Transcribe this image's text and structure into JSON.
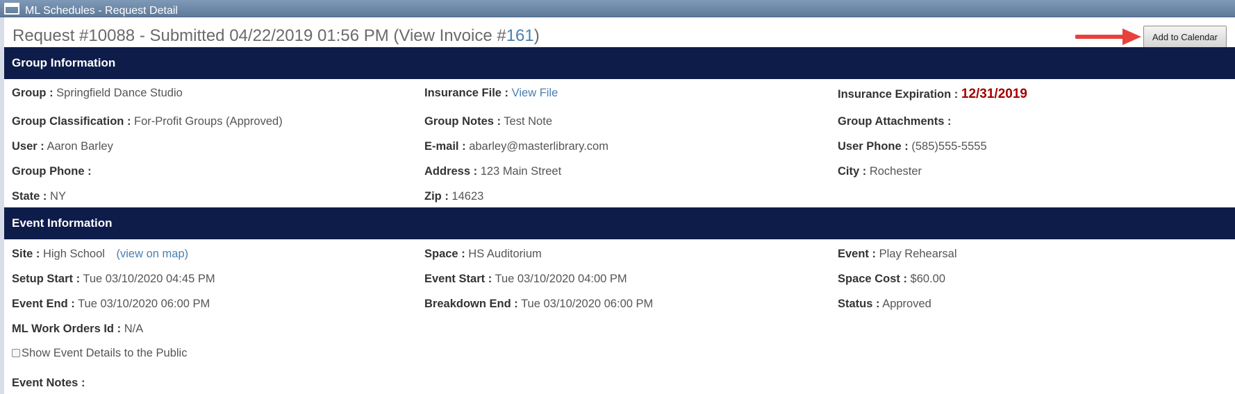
{
  "window": {
    "title": "ML Schedules - Request Detail"
  },
  "request": {
    "title_prefix": "Request #10088 - Submitted 04/22/2019 01:56 PM (View Invoice #",
    "invoice_number": "161",
    "title_suffix": ")"
  },
  "toolbar": {
    "add_to_calendar_label": "Add to Calendar",
    "arrow_color": "#e8413c"
  },
  "group_section": {
    "header": "Group Information",
    "group": {
      "label": "Group :",
      "value": "Springfield Dance Studio"
    },
    "insurance_file": {
      "label": "Insurance File :",
      "value": "View File"
    },
    "insurance_expiration": {
      "label": "Insurance Expiration :",
      "value": "12/31/2019"
    },
    "classification": {
      "label": "Group Classification :",
      "value": "For-Profit Groups (Approved)"
    },
    "notes": {
      "label": "Group Notes :",
      "value": "Test Note"
    },
    "attachments": {
      "label": "Group Attachments :",
      "value": ""
    },
    "user": {
      "label": "User :",
      "value": "Aaron Barley"
    },
    "email": {
      "label": "E-mail :",
      "value": "abarley@masterlibrary.com"
    },
    "user_phone": {
      "label": "User Phone :",
      "value": "(585)555-5555"
    },
    "group_phone": {
      "label": "Group Phone :",
      "value": ""
    },
    "address": {
      "label": "Address :",
      "value": "123 Main Street"
    },
    "city": {
      "label": "City :",
      "value": "Rochester"
    },
    "state": {
      "label": "State :",
      "value": "NY"
    },
    "zip": {
      "label": "Zip :",
      "value": "14623"
    }
  },
  "event_section": {
    "header": "Event Information",
    "site": {
      "label": "Site :",
      "value": "High School",
      "map_link": "(view on map)"
    },
    "space": {
      "label": "Space :",
      "value": "HS Auditorium"
    },
    "event": {
      "label": "Event :",
      "value": "Play Rehearsal"
    },
    "setup_start": {
      "label": "Setup Start :",
      "value": "Tue 03/10/2020 04:45 PM"
    },
    "event_start": {
      "label": "Event Start :",
      "value": "Tue 03/10/2020 04:00 PM"
    },
    "space_cost": {
      "label": "Space Cost :",
      "value": "$60.00"
    },
    "event_end": {
      "label": "Event End :",
      "value": "Tue 03/10/2020 06:00 PM"
    },
    "breakdown_end": {
      "label": "Breakdown End :",
      "value": "Tue 03/10/2020 06:00 PM"
    },
    "status": {
      "label": "Status :",
      "value": "Approved"
    },
    "work_orders": {
      "label": "ML Work Orders Id :",
      "value": "N/A"
    },
    "show_public": {
      "label": "Show Event Details to the Public",
      "checked": false
    },
    "event_notes": {
      "label": "Event Notes :",
      "value": ""
    }
  }
}
